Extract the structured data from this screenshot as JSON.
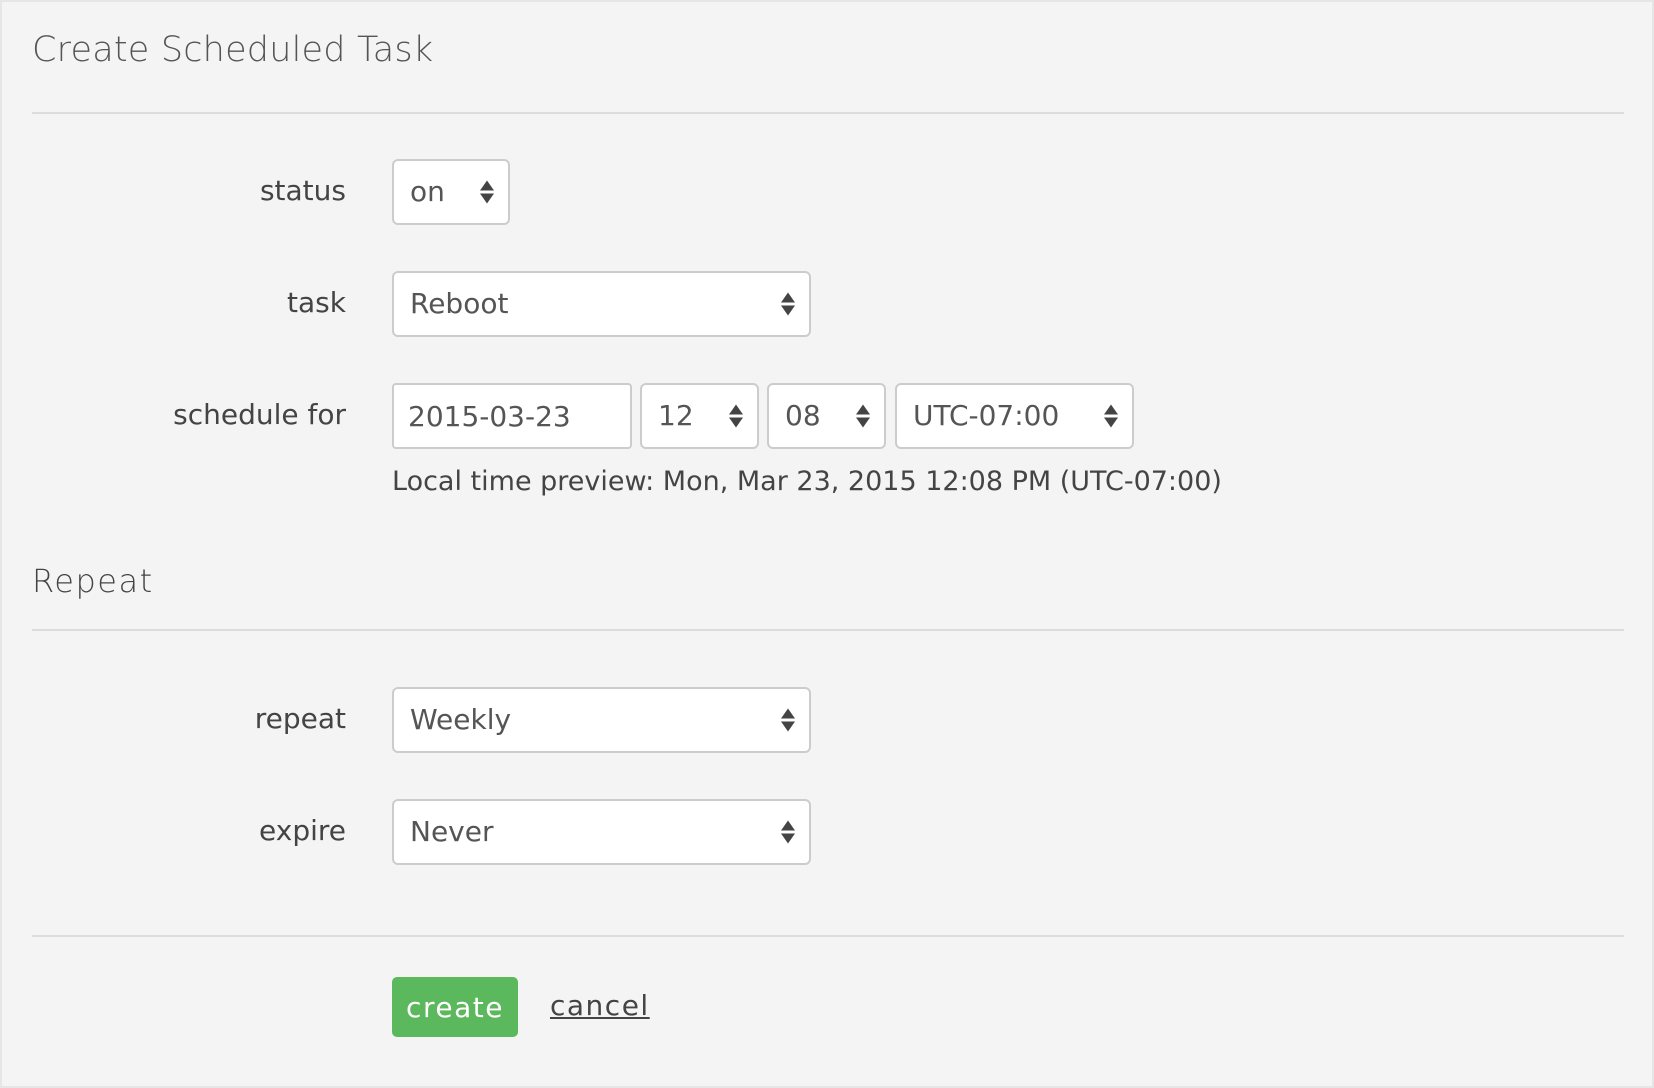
{
  "page": {
    "title": "Create Scheduled Task"
  },
  "form": {
    "status": {
      "label": "status",
      "value": "on"
    },
    "task": {
      "label": "task",
      "value": "Reboot"
    },
    "schedule": {
      "label": "schedule for",
      "date": "2015-03-23",
      "hour": "12",
      "minute": "08",
      "timezone": "UTC-07:00",
      "preview": "Local time preview: Mon, Mar 23, 2015 12:08 PM (UTC-07:00)"
    }
  },
  "repeat_section": {
    "title": "Repeat",
    "repeat": {
      "label": "repeat",
      "value": "Weekly"
    },
    "expire": {
      "label": "expire",
      "value": "Never"
    }
  },
  "actions": {
    "create_label": "create",
    "cancel_label": "cancel"
  },
  "colors": {
    "create_button": "#5cb85c",
    "panel_background": "#f4f4f4"
  },
  "icons": {
    "select_arrows": "up-down-arrows-icon"
  }
}
